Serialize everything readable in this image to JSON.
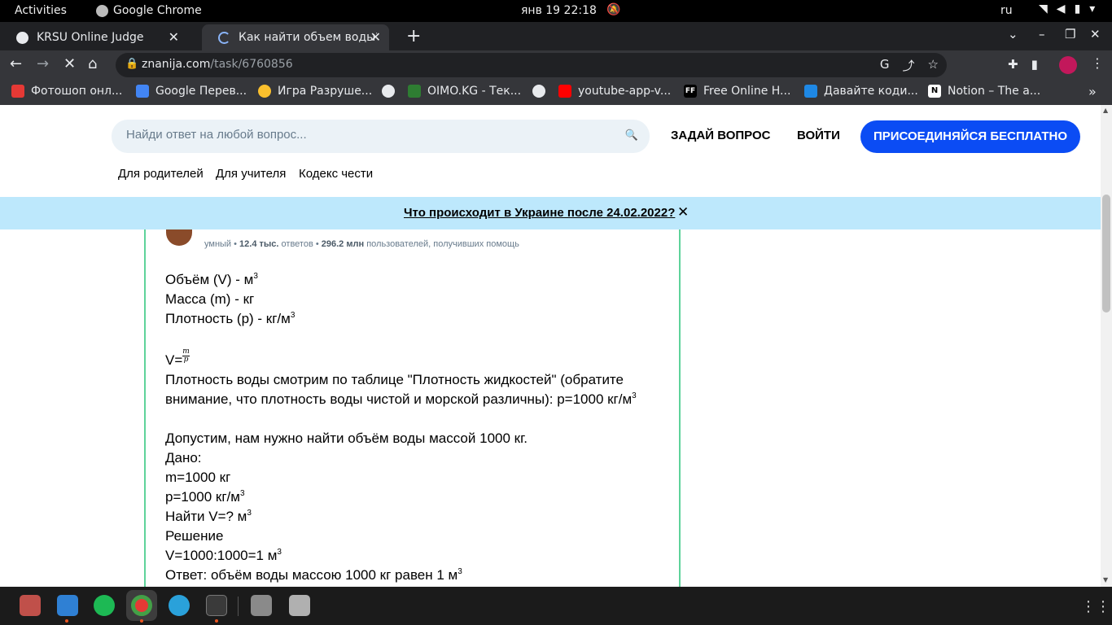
{
  "topbar": {
    "activities": "Activities",
    "app_name": "Google Chrome",
    "clock": "янв 19  22:18",
    "lang": "ru"
  },
  "tabs": [
    {
      "title": "KRSU Online Judge",
      "active": false
    },
    {
      "title": "Как найти объем воды??? ",
      "active": true
    }
  ],
  "address": {
    "domain": "znanija.com",
    "path": "/task/6760856"
  },
  "bookmarks": [
    {
      "label": "Фотошоп онл...",
      "icon": "arrow-red-icon",
      "color": "#e53935"
    },
    {
      "label": "Google Перев...",
      "icon": "google-translate-icon",
      "color": "#4285f4"
    },
    {
      "label": "Игра Разруше...",
      "icon": "game-icon",
      "color": "#fbc02d"
    },
    {
      "label": "",
      "icon": "globe-icon",
      "color": "#e8eaed"
    },
    {
      "label": "OIMO.KG - Тек...",
      "icon": "test-icon",
      "color": "#2e7d32"
    },
    {
      "label": "",
      "icon": "globe-icon",
      "color": "#e8eaed"
    },
    {
      "label": "youtube-app-v...",
      "icon": "youtube-icon",
      "color": "#ff0000"
    },
    {
      "label": "Free Online H...",
      "icon": "ff-icon",
      "color": "#000000"
    },
    {
      "label": "Давайте коди...",
      "icon": "code-icon",
      "color": "#1e88e5"
    },
    {
      "label": "Notion – The a...",
      "icon": "notion-icon",
      "color": "#ffffff"
    }
  ],
  "header": {
    "search_placeholder": "Найди ответ на любой вопрос...",
    "ask": "ЗАДАЙ ВОПРОС",
    "login": "ВОЙТИ",
    "join": "ПРИСОЕДИНЯЙСЯ БЕСПЛАТНО",
    "subnav": [
      "Для родителей",
      "Для учителя",
      "Кодекс чести"
    ]
  },
  "banner": {
    "text": "Что происходит в Украине после 24.02.2022?"
  },
  "answer": {
    "meta": {
      "rank": "умный",
      "answers_count": "12.4 тыс.",
      "answers_label": "ответов",
      "helped_count": "296.2 млн",
      "helped_label": "пользователей, получивших помощь"
    },
    "lines": [
      {
        "text": "Объём (V) - м",
        "sup": "3"
      },
      {
        "text": "Масса (m) - кг",
        "sup": ""
      },
      {
        "text": "Плотность (p) - кг/м",
        "sup": "3"
      },
      {
        "text": "",
        "sup": ""
      },
      {
        "text": "V=",
        "sup": "",
        "frac": {
          "num": "m",
          "den": "p"
        }
      },
      {
        "text": "Плотность воды смотрим по таблице \"Плотность жидкостей\" (обратите",
        "sup": ""
      },
      {
        "text": "внимание, что плотность воды чистой и морской различны): p=1000 кг/м",
        "sup": "3"
      },
      {
        "text": "",
        "sup": ""
      },
      {
        "text": "Допустим, нам нужно найти объём воды массой 1000 кг.",
        "sup": ""
      },
      {
        "text": "Дано:",
        "sup": ""
      },
      {
        "text": "m=1000 кг",
        "sup": ""
      },
      {
        "text": "p=1000 кг/м",
        "sup": "3"
      },
      {
        "text": "Найти V=? м",
        "sup": "3"
      },
      {
        "text": "Решение",
        "sup": ""
      },
      {
        "text": "V=1000:1000=1 м",
        "sup": "3"
      },
      {
        "text": "Ответ: объём воды массою 1000 кг равен 1 м",
        "sup": "3"
      }
    ]
  },
  "colors": {
    "brand_blue": "#0b4cf4",
    "banner": "#bde8fc",
    "answer_border": "#5ed39a"
  }
}
